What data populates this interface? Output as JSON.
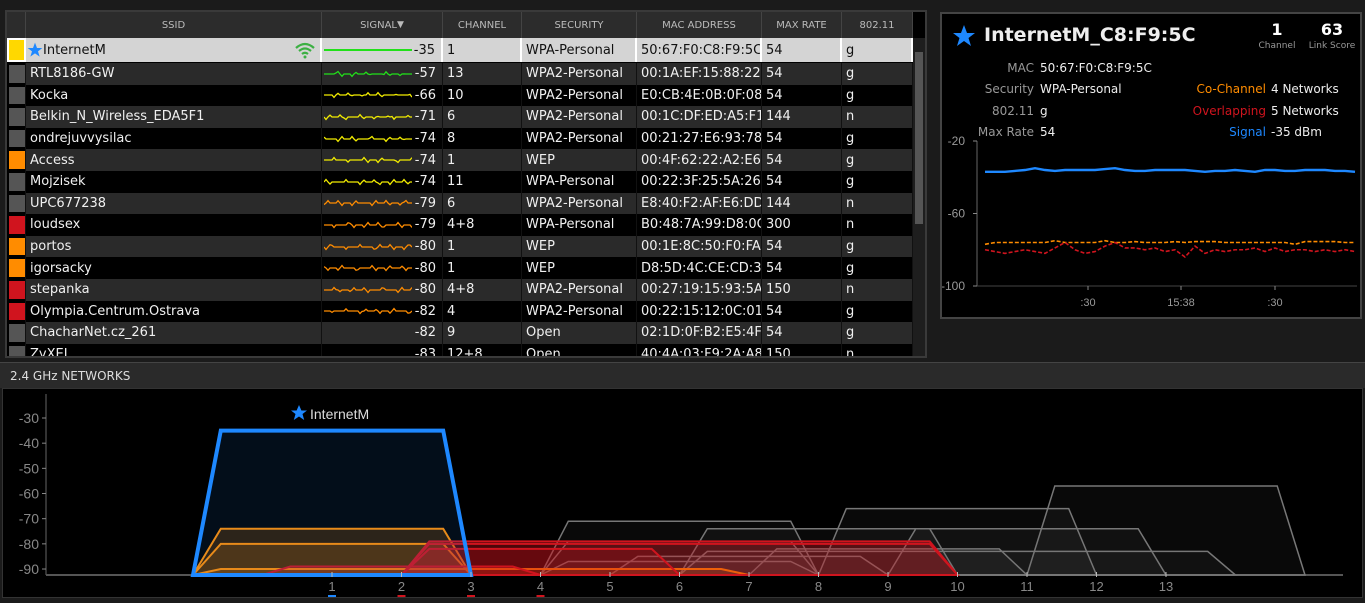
{
  "table": {
    "columns": [
      "SSID",
      "SIGNAL",
      "CHANNEL",
      "SECURITY",
      "MAC ADDRESS",
      "MAX RATE",
      "802.11"
    ],
    "sort_icon": "triangle-down-icon",
    "rows": [
      {
        "ssid": "InternetM",
        "signal": "-35",
        "channel": "1",
        "security": "WPA-Personal",
        "mac": "50:67:F0:C8:F9:5C",
        "rate": "54",
        "mode": "g",
        "swatch": "#ffd800",
        "starred": true,
        "connected": true
      },
      {
        "ssid": "RTL8186-GW",
        "signal": "-57",
        "channel": "13",
        "security": "WPA2-Personal",
        "mac": "00:1A:EF:15:88:22",
        "rate": "54",
        "mode": "g",
        "swatch": "#555555"
      },
      {
        "ssid": "Kocka",
        "signal": "-66",
        "channel": "10",
        "security": "WPA2-Personal",
        "mac": "E0:CB:4E:0B:0F:08",
        "rate": "54",
        "mode": "g",
        "swatch": "#555555"
      },
      {
        "ssid": "Belkin_N_Wireless_EDA5F1",
        "signal": "-71",
        "channel": "6",
        "security": "WPA2-Personal",
        "mac": "00:1C:DF:ED:A5:F1",
        "rate": "144",
        "mode": "n",
        "swatch": "#555555"
      },
      {
        "ssid": "ondrejuvvysilac",
        "signal": "-74",
        "channel": "8",
        "security": "WPA2-Personal",
        "mac": "00:21:27:E6:93:78",
        "rate": "54",
        "mode": "g",
        "swatch": "#555555"
      },
      {
        "ssid": "Access",
        "signal": "-74",
        "channel": "1",
        "security": "WEP",
        "mac": "00:4F:62:22:A2:E6",
        "rate": "54",
        "mode": "g",
        "swatch": "#ff8c00"
      },
      {
        "ssid": "Mojzisek",
        "signal": "-74",
        "channel": "11",
        "security": "WPA-Personal",
        "mac": "00:22:3F:25:5A:26",
        "rate": "54",
        "mode": "g",
        "swatch": "#555555"
      },
      {
        "ssid": "UPC677238",
        "signal": "-79",
        "channel": "6",
        "security": "WPA2-Personal",
        "mac": "E8:40:F2:AF:E6:DD",
        "rate": "144",
        "mode": "n",
        "swatch": "#555555"
      },
      {
        "ssid": "loudsex",
        "signal": "-79",
        "channel": "4+8",
        "security": "WPA-Personal",
        "mac": "B0:48:7A:99:D8:0C",
        "rate": "300",
        "mode": "n",
        "swatch": "#d0141e"
      },
      {
        "ssid": "portos",
        "signal": "-80",
        "channel": "1",
        "security": "WEP",
        "mac": "00:1E:8C:50:F0:FA",
        "rate": "54",
        "mode": "g",
        "swatch": "#ff8c00"
      },
      {
        "ssid": "igorsacky",
        "signal": "-80",
        "channel": "1",
        "security": "WEP",
        "mac": "D8:5D:4C:CE:CD:3E",
        "rate": "54",
        "mode": "g",
        "swatch": "#ff8c00"
      },
      {
        "ssid": "stepanka",
        "signal": "-80",
        "channel": "4+8",
        "security": "WPA2-Personal",
        "mac": "00:27:19:15:93:5A",
        "rate": "150",
        "mode": "n",
        "swatch": "#d0141e"
      },
      {
        "ssid": "Olympia.Centrum.Ostrava",
        "signal": "-82",
        "channel": "4",
        "security": "WPA2-Personal",
        "mac": "00:22:15:12:0C:01",
        "rate": "54",
        "mode": "g",
        "swatch": "#d0141e"
      },
      {
        "ssid": "ChacharNet.cz_261",
        "signal": "-82",
        "channel": "9",
        "security": "Open",
        "mac": "02:1D:0F:B2:E5:4F",
        "rate": "54",
        "mode": "g",
        "swatch": "#555555",
        "no_spark": true
      },
      {
        "ssid": "ZyXEL",
        "signal": "-83",
        "channel": "12+8",
        "security": "Open",
        "mac": "40:4A:03:F9:2A:A8",
        "rate": "150",
        "mode": "n",
        "swatch": "#555555",
        "no_spark": true
      }
    ]
  },
  "detail": {
    "title": "InternetM_C8:F9:5C",
    "channel": "1",
    "channel_label": "Channel",
    "link_score": "63",
    "link_score_label": "Link Score",
    "mac_label": "MAC",
    "mac": "50:67:F0:C8:F9:5C",
    "security_label": "Security",
    "security": "WPA-Personal",
    "mode_label": "802.11",
    "mode": "g",
    "rate_label": "Max Rate",
    "rate": "54",
    "cochannel_label": "Co-Channel",
    "cochannel": "4 Networks",
    "overlap_label": "Overlapping",
    "overlap": "5 Networks",
    "signal_label": "Signal",
    "signal": "-35 dBm",
    "colors": {
      "signal": "#1e88ff",
      "cochannel": "#ff8c00",
      "overlap": "#d0141e"
    }
  },
  "band_title": "2.4 GHz NETWORKS",
  "chart_data": [
    {
      "type": "line",
      "title": "Signal history",
      "ylim": [
        -100,
        -20
      ],
      "yticks": [
        -20,
        -60,
        -100
      ],
      "xticks": [
        ":30",
        "15:38",
        ":30"
      ],
      "series": [
        {
          "name": "Signal",
          "color": "#1e88ff",
          "dash": false,
          "values": [
            -37,
            -37,
            -37,
            -36.5,
            -36,
            -35,
            -36,
            -36.5,
            -36,
            -36,
            -36,
            -36,
            -35.5,
            -35,
            -36,
            -36.5,
            -36.5,
            -36,
            -36,
            -36,
            -36,
            -36.5,
            -37,
            -36.5,
            -36.5,
            -36,
            -36.5,
            -37,
            -36,
            -36,
            -36.5,
            -36.5,
            -36,
            -36,
            -36,
            -36.5,
            -36.5,
            -37
          ]
        },
        {
          "name": "Co-Channel",
          "color": "#ff8c00",
          "dash": true,
          "values": [
            -77,
            -76,
            -76,
            -76,
            -76,
            -76,
            -76,
            -75,
            -76,
            -76,
            -76,
            -76,
            -75,
            -76,
            -76,
            -75.5,
            -76,
            -76,
            -76,
            -75.5,
            -76,
            -75.5,
            -75.5,
            -75.5,
            -76,
            -76,
            -76,
            -76,
            -76,
            -76,
            -76,
            -77,
            -75.5,
            -75.5,
            -75.5,
            -75.5,
            -76,
            -76
          ]
        },
        {
          "name": "Overlapping",
          "color": "#d0141e",
          "dash": true,
          "values": [
            -80,
            -81,
            -82,
            -81,
            -80,
            -81,
            -82,
            -79,
            -76,
            -80,
            -82,
            -81,
            -78,
            -76,
            -79,
            -79,
            -80,
            -79,
            -81,
            -80,
            -84,
            -78,
            -82,
            -80,
            -81,
            -80,
            -80,
            -79,
            -81,
            -79,
            -81,
            -80,
            -80,
            -81,
            -80,
            -81,
            -80,
            -81
          ]
        }
      ]
    },
    {
      "type": "area",
      "title": "2.4 GHz NETWORKS",
      "xlabel": "Channel",
      "ylim": [
        -93,
        -25
      ],
      "yticks": [
        -30,
        -40,
        -50,
        -60,
        -70,
        -80,
        -90
      ],
      "xticks": [
        "1",
        "2",
        "3",
        "4",
        "5",
        "6",
        "7",
        "8",
        "9",
        "10",
        "11",
        "12",
        "13"
      ],
      "highlight_label": "InternetM",
      "networks": [
        {
          "center": 13,
          "width": 20,
          "signal": -57,
          "kind": "other"
        },
        {
          "center": 10,
          "width": 20,
          "signal": -66,
          "kind": "other"
        },
        {
          "center": 6,
          "width": 20,
          "signal": -71,
          "kind": "other"
        },
        {
          "center": 8,
          "width": 20,
          "signal": -74,
          "kind": "other"
        },
        {
          "center": 11,
          "width": 20,
          "signal": -74,
          "kind": "other"
        },
        {
          "center": 6,
          "width": 20,
          "signal": -79,
          "kind": "other"
        },
        {
          "center": 9,
          "width": 20,
          "signal": -82,
          "kind": "other"
        },
        {
          "center": 10,
          "width": 40,
          "signal": -83,
          "kind": "other"
        },
        {
          "center": 7,
          "width": 20,
          "signal": -85,
          "kind": "other"
        },
        {
          "center": 6,
          "width": 20,
          "signal": -87,
          "kind": "other"
        },
        {
          "center": 3,
          "width": 40,
          "signal": -90,
          "kind": "cochannel"
        },
        {
          "center": 1,
          "width": 20,
          "signal": -74,
          "kind": "cochannel"
        },
        {
          "center": 1,
          "width": 20,
          "signal": -80,
          "kind": "cochannel"
        },
        {
          "center": 2,
          "width": 20,
          "signal": -89,
          "kind": "overlap"
        },
        {
          "center": 4,
          "width": 20,
          "signal": -82,
          "kind": "overlap"
        },
        {
          "center": 6,
          "width": 40,
          "signal": -80,
          "kind": "overlap"
        },
        {
          "center": 6,
          "width": 40,
          "signal": -79,
          "kind": "overlap"
        },
        {
          "center": 1,
          "width": 20,
          "signal": -35,
          "kind": "selected"
        }
      ],
      "channel_markers": {
        "1": "#1e88ff",
        "2": "#d0141e",
        "3": "#d0141e",
        "4": "#d0141e"
      },
      "colors": {
        "selected": "#1e88ff",
        "cochannel": "#ff8c00",
        "overlap": "#d0141e",
        "other": "#777777"
      }
    }
  ]
}
